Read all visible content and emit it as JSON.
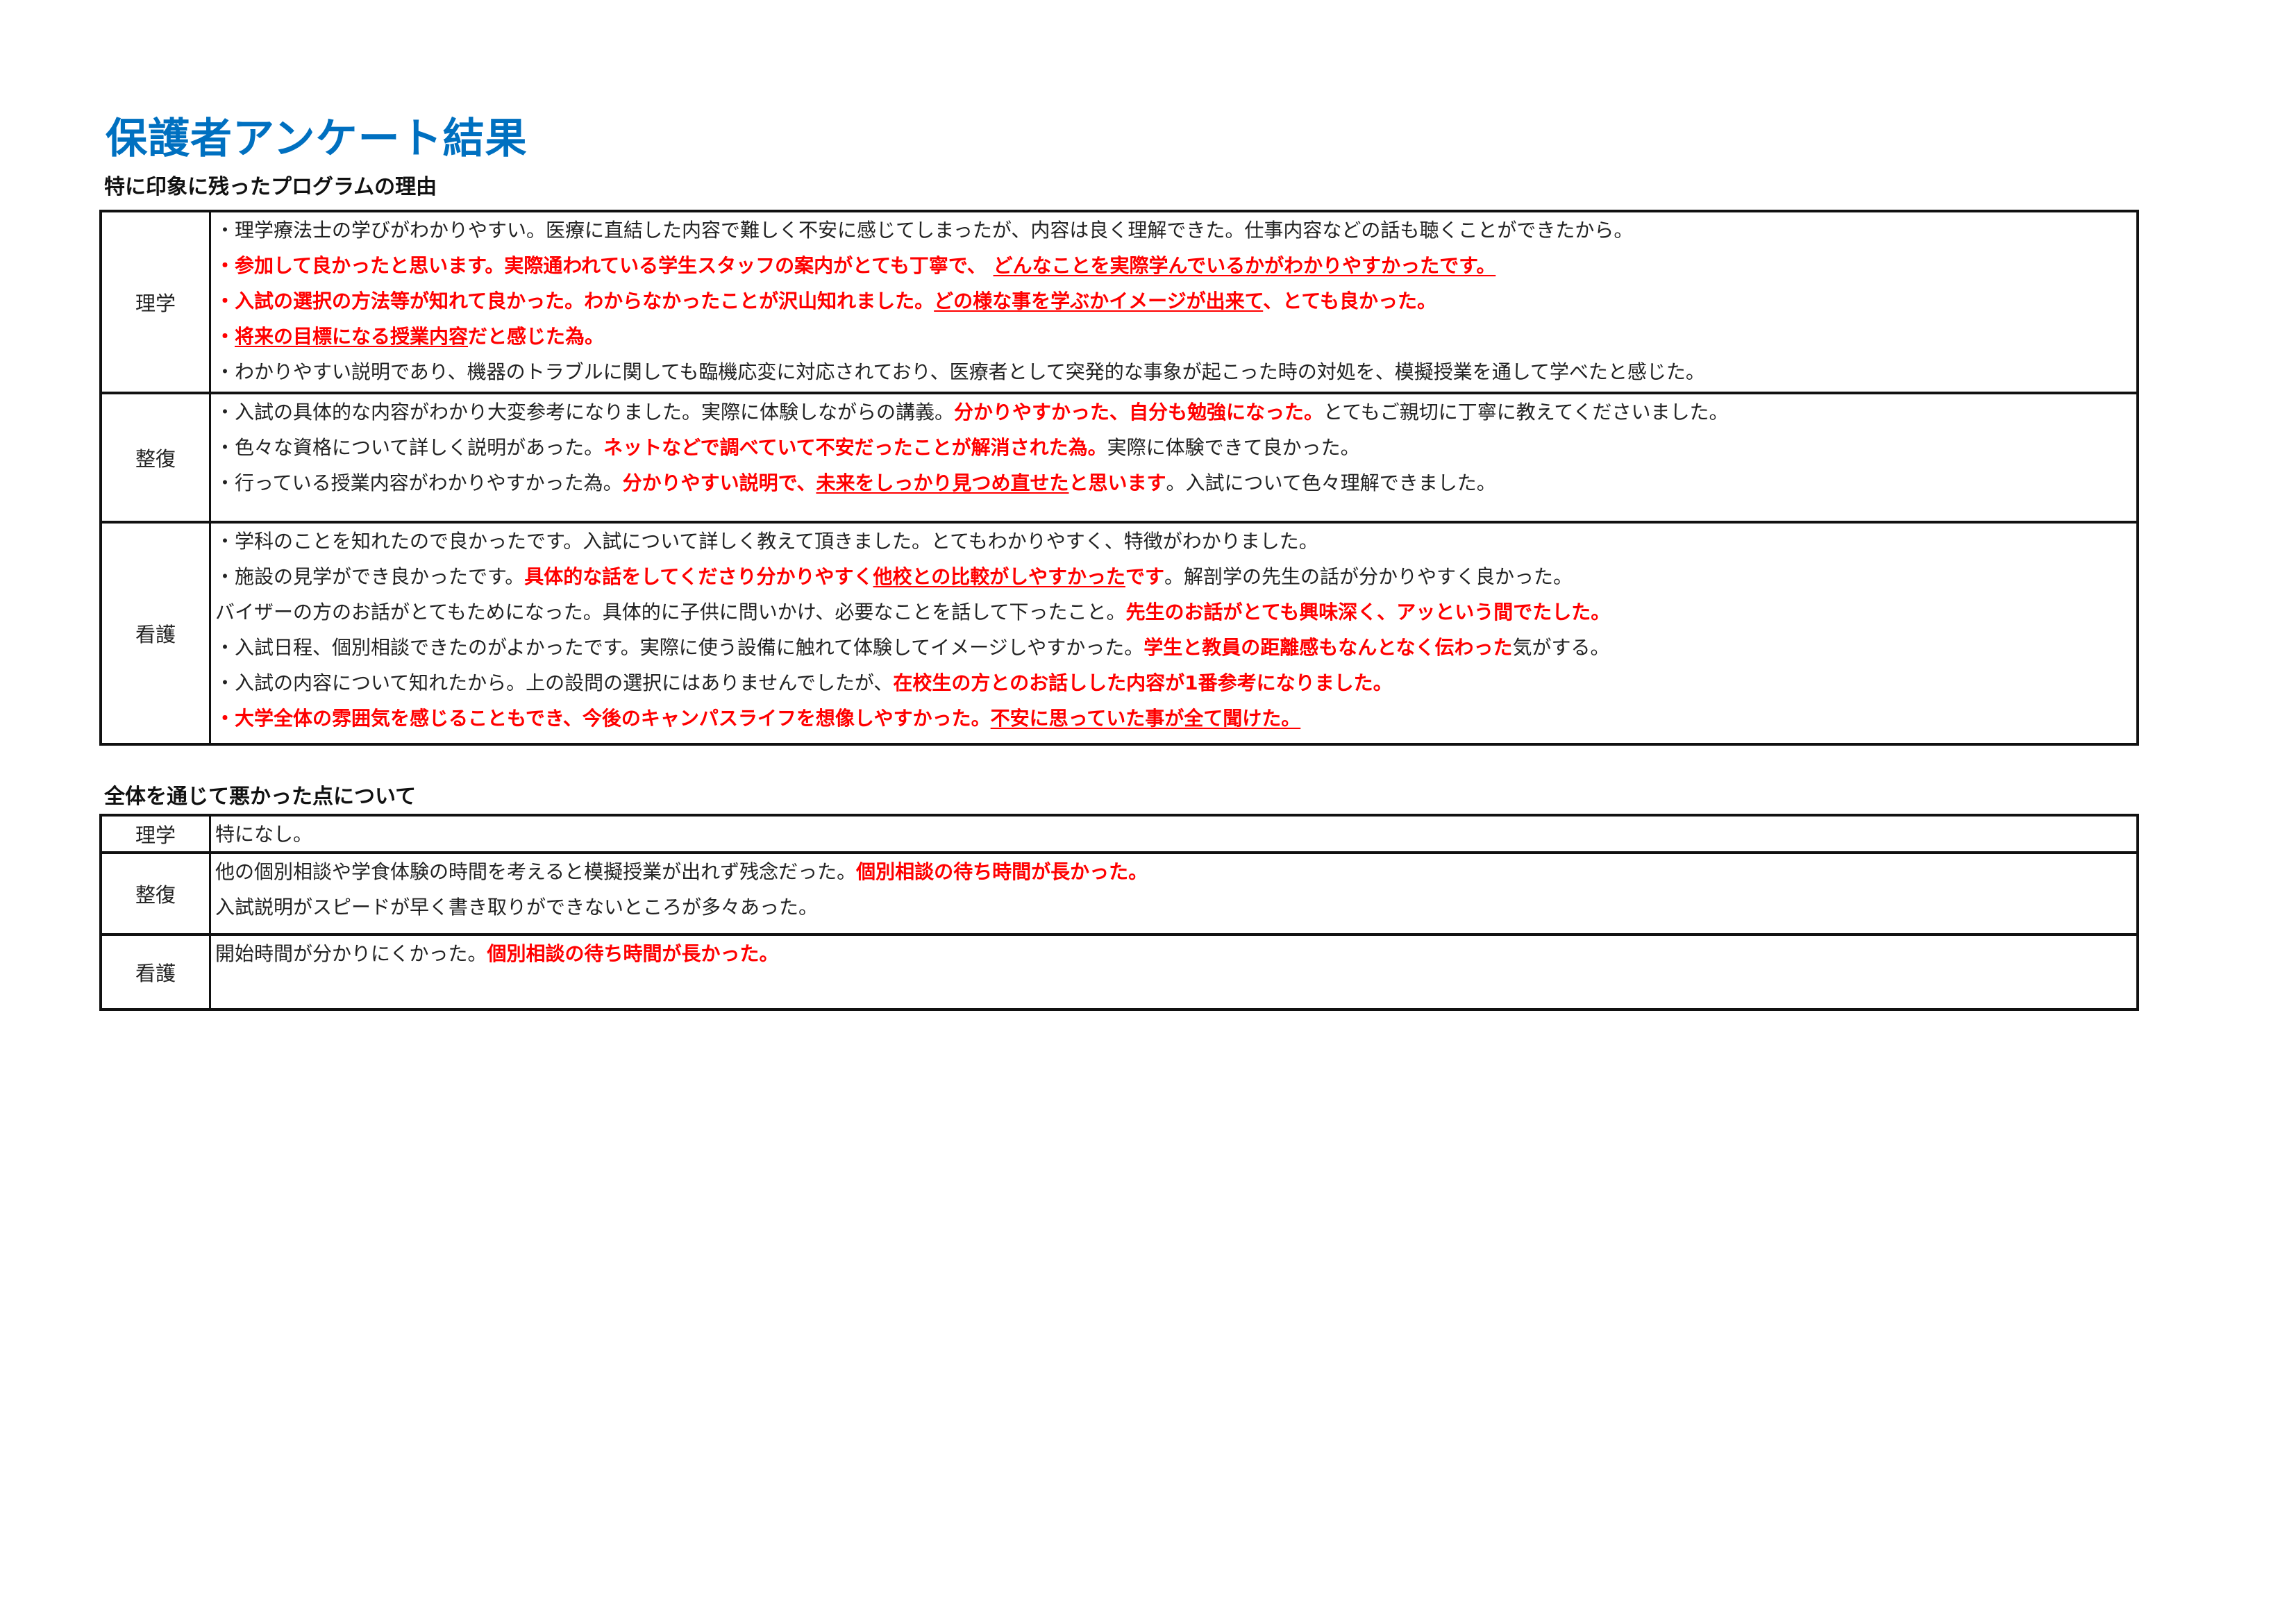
{
  "title": "保護者アンケート結果",
  "accent_color": "#0070c0",
  "highlight_color": "#ff0000",
  "section1": {
    "heading": "特に印象に残ったプログラムの理由",
    "rows": [
      {
        "dept": "理学",
        "lines": [
          [
            {
              "t": "・理学療法士の学びがわかりやすい。医療に直結した内容で難しく不安に感じてしまったが、内容は良く理解できた。仕事内容などの話も聴くことができたから。",
              "s": "n"
            }
          ],
          [
            {
              "t": "・参加して良かったと思います。実際通われている学生スタッフの案内がとても丁寧で、 ",
              "s": "r"
            },
            {
              "t": "どんなことを実際学んでいるかがわかりやすかったです。",
              "s": "ru"
            }
          ],
          [
            {
              "t": "・入試の選択の方法等が知れて良かった。わからなかったことが沢山知れました。",
              "s": "r"
            },
            {
              "t": "どの様な事を学ぶかイメージが出来て",
              "s": "ru"
            },
            {
              "t": "、とても良かった。",
              "s": "r"
            }
          ],
          [
            {
              "t": "・",
              "s": "r"
            },
            {
              "t": "将来の目標になる授業内容",
              "s": "ru"
            },
            {
              "t": "だと感じた為。",
              "s": "r"
            }
          ],
          [
            {
              "t": "・わかりやすい説明であり、機器のトラブルに関しても臨機応変に対応されており、医療者として突発的な事象が起こった時の対処を、模擬授業を通して学べたと感じた。",
              "s": "n"
            }
          ]
        ]
      },
      {
        "dept": "整復",
        "lines": [
          [
            {
              "t": "・入試の具体的な内容がわかり大変参考になりました。実際に体験しながらの講義。",
              "s": "n"
            },
            {
              "t": "分かりやすかった、自分も勉強になった。",
              "s": "r"
            },
            {
              "t": "とてもご親切に丁寧に教えてくださいました。",
              "s": "n"
            }
          ],
          [
            {
              "t": "・色々な資格について詳しく説明があった。",
              "s": "n"
            },
            {
              "t": "ネットなどで調べていて不安だったことが解消された為。",
              "s": "r"
            },
            {
              "t": "実際に体験できて良かった。",
              "s": "n"
            }
          ],
          [
            {
              "t": "・行っている授業内容がわかりやすかった為。",
              "s": "n"
            },
            {
              "t": "分かりやすい説明で、",
              "s": "r"
            },
            {
              "t": "未来をしっかり見つめ直せた",
              "s": "ru"
            },
            {
              "t": "と思います",
              "s": "r"
            },
            {
              "t": "。入試について色々理解できました。",
              "s": "n"
            }
          ]
        ]
      },
      {
        "dept": "看護",
        "lines": [
          [
            {
              "t": "・学科のことを知れたので良かったです。入試について詳しく教えて頂きました。とてもわかりやすく、特徴がわかりました。",
              "s": "n"
            }
          ],
          [
            {
              "t": "・施設の見学ができ良かったです。",
              "s": "n"
            },
            {
              "t": "具体的な話をしてくださり分かりやすく",
              "s": "r"
            },
            {
              "t": "他校との比較がしやすかった",
              "s": "ru"
            },
            {
              "t": "です",
              "s": "r"
            },
            {
              "t": "。解剖学の先生の話が分かりやすく良かった。",
              "s": "n"
            }
          ],
          [
            {
              "t": "バイザーの方のお話がとてもためになった。具体的に子供に問いかけ、必要なことを話して下ったこと。",
              "s": "n"
            },
            {
              "t": "先生のお話がとても興味深く、アッという間でたした。",
              "s": "r"
            }
          ],
          [
            {
              "t": "・入試日程、個別相談できたのがよかったです。実際に使う設備に触れて体験してイメージしやすかった。",
              "s": "n"
            },
            {
              "t": "学生と教員の距離感もなんとなく伝わった",
              "s": "r"
            },
            {
              "t": "気がする。",
              "s": "n"
            }
          ],
          [
            {
              "t": "・入試の内容について知れたから。上の設問の選択にはありませんでしたが、",
              "s": "n"
            },
            {
              "t": "在校生の方とのお話しした内容が1番参考になりました。",
              "s": "r"
            }
          ],
          [
            {
              "t": "・大学全体の雰囲気を感じることもでき、今後のキャンパスライフを想像しやすかった。",
              "s": "r"
            },
            {
              "t": "不安に思っていた事が全て聞けた。",
              "s": "ru"
            }
          ]
        ]
      }
    ]
  },
  "section2": {
    "heading": "全体を通じて悪かった点について",
    "rows": [
      {
        "dept": "理学",
        "lines": [
          [
            {
              "t": "特になし。",
              "s": "n"
            }
          ]
        ]
      },
      {
        "dept": "整復",
        "lines": [
          [
            {
              "t": "他の個別相談や学食体験の時間を考えると模擬授業が出れず残念だった。",
              "s": "n"
            },
            {
              "t": "個別相談の待ち時間が長かった。",
              "s": "r"
            }
          ],
          [
            {
              "t": "入試説明がスピードが早く書き取りができないところが多々あった。",
              "s": "n"
            }
          ]
        ]
      },
      {
        "dept": "看護",
        "lines": [
          [
            {
              "t": "開始時間が分かりにくかった。",
              "s": "n"
            },
            {
              "t": "個別相談の待ち時間が長かった。",
              "s": "r"
            }
          ]
        ]
      }
    ]
  }
}
